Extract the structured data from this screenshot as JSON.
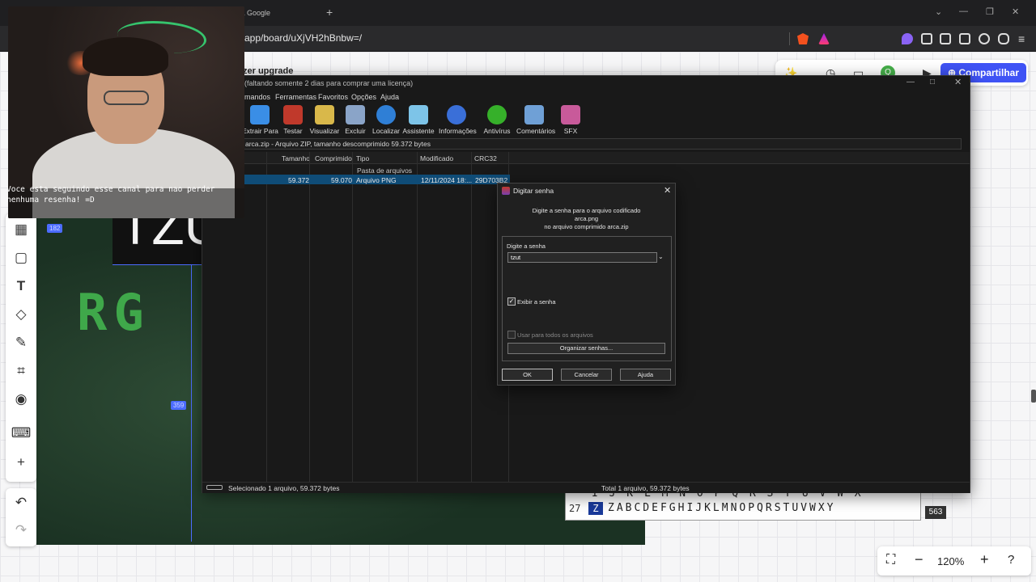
{
  "browser": {
    "tab_title": "uisa Google",
    "url": "app/board/uXjVH2hBnbw=/"
  },
  "board": {
    "upgrade_label": "zer upgrade",
    "share_label": "Compartilhar",
    "avatar_initial": "Q",
    "zoom_level": "120%",
    "canvas_text": "TZU",
    "canvas_green_text": "RG",
    "dim_badges": [
      "182",
      "359"
    ],
    "alphabet_row1": "I J K L M N O P Q R S T U V W X",
    "alphabet_row_num": "27",
    "alphabet_z": "Z",
    "alphabet_row2": "ZABCDEFGHIJKLMNOPQRSTUVWXY",
    "alphabet_badge": "563"
  },
  "webcam": {
    "caption_line1": "Voce esta seguindo esse canal para nao perder",
    "caption_line2": "nenhuma resenha! =D"
  },
  "winrar": {
    "title": "(faltando somente 2 dias para comprar uma licença)",
    "menu": [
      "mandos",
      "Ferramentas",
      "Favoritos",
      "Opções",
      "Ajuda"
    ],
    "tools": [
      {
        "label": "Extrair Para",
        "icon": "folder-extract-icon",
        "color": "#3a8ee6"
      },
      {
        "label": "Testar",
        "icon": "test-icon",
        "color": "#c0392b"
      },
      {
        "label": "Visualizar",
        "icon": "book-icon",
        "color": "#d9b84a"
      },
      {
        "label": "Excluir",
        "icon": "trash-icon",
        "color": "#8aa4c8"
      },
      {
        "label": "Localizar",
        "icon": "magnifier-icon",
        "color": "#2f7fd6"
      },
      {
        "label": "Assistente",
        "icon": "wizard-icon",
        "color": "#7dc4e8"
      },
      {
        "label": "Informações",
        "icon": "info-icon",
        "color": "#3a6fd8"
      },
      {
        "label": "Antivírus",
        "icon": "antivirus-icon",
        "color": "#36b02a"
      },
      {
        "label": "Comentários",
        "icon": "comments-icon",
        "color": "#6fa0d6"
      },
      {
        "label": "SFX",
        "icon": "sfx-icon",
        "color": "#c85a9a"
      }
    ],
    "path": "arca.zip - Arquivo ZIP, tamanho descomprimido 59.372 bytes",
    "columns": [
      "Tamanho",
      "Comprimido",
      "Tipo",
      "Modificado",
      "CRC32"
    ],
    "folder_row_type": "Pasta de arquivos",
    "file_row": {
      "size": "59.372",
      "compressed": "59.070",
      "type": "Arquivo PNG",
      "modified": "12/11/2024 18:...",
      "crc": "29D703B2"
    },
    "status_left": "Selecionado 1 arquivo, 59.372 bytes",
    "status_right": "Total 1 arquivo, 59.372 bytes"
  },
  "dialog": {
    "title": "Digitar senha",
    "msg1": "Digite a senha para o arquivo codificado",
    "msg2": "arca.png",
    "msg3": "no arquivo comprimido arca.zip",
    "pw_label": "Digite a senha",
    "pw_value": "tzut",
    "show_pw_label": "Exibir a senha",
    "use_all_label": "Usar para todos os arquivos",
    "org_label": "Organizar senhas...",
    "ok_label": "OK",
    "cancel_label": "Cancelar",
    "help_label": "Ajuda"
  }
}
